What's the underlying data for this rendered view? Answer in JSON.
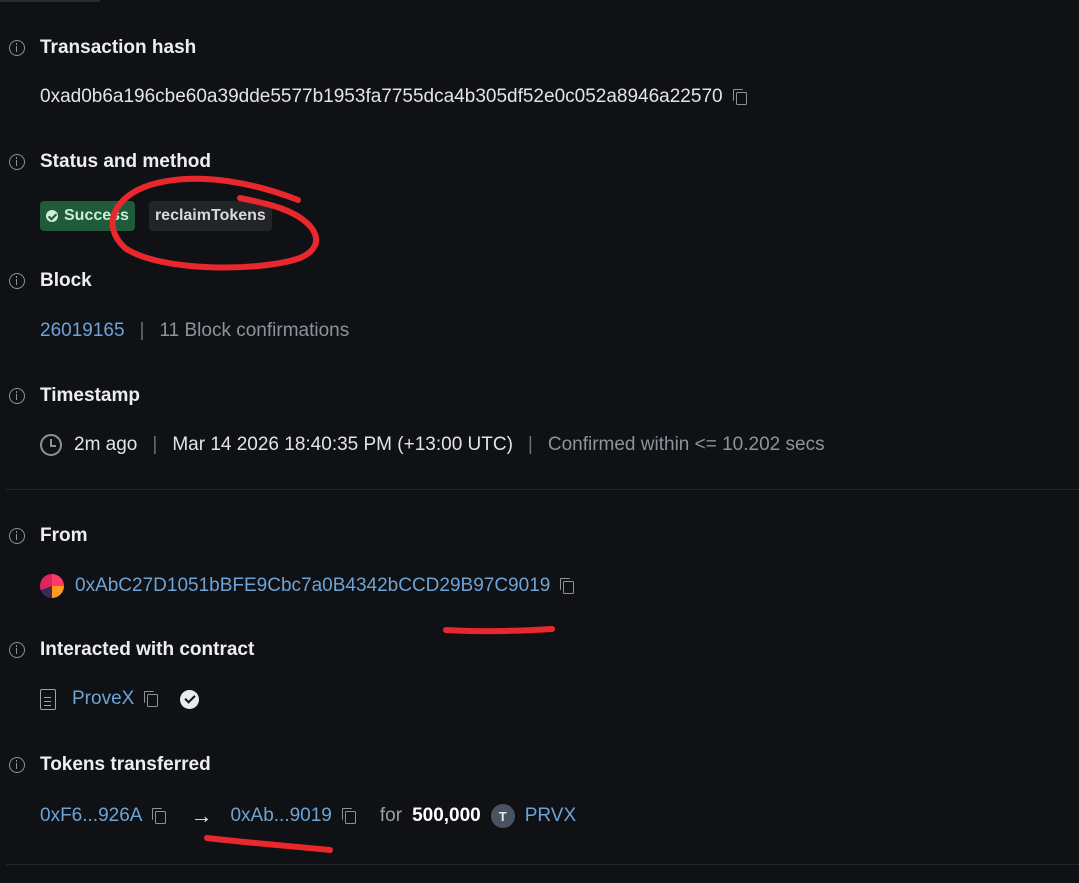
{
  "transaction_hash": {
    "label": "Transaction hash",
    "value": "0xad0b6a196cbe60a39dde5577b1953fa7755dca4b305df52e0c052a8946a22570"
  },
  "status_method": {
    "label": "Status and method",
    "status": "Success",
    "method": "reclaimTokens"
  },
  "block": {
    "label": "Block",
    "number": "26019165",
    "separator": "|",
    "confirmations": "11 Block confirmations"
  },
  "timestamp": {
    "label": "Timestamp",
    "relative": "2m ago",
    "separator": "|",
    "datetime": "Mar 14 2026 18:40:35 PM (+13:00 UTC)",
    "confirmed": "Confirmed within <= 10.202 secs"
  },
  "from": {
    "label": "From",
    "address": "0xAbC27D1051bBFE9Cbc7a0B4342bCCD29B97C9019"
  },
  "contract": {
    "label": "Interacted with contract",
    "name": "ProveX"
  },
  "tokens": {
    "label": "Tokens transferred",
    "from_short": "0xF6...926A",
    "arrow": "→",
    "to_short": "0xAb...9019",
    "for_word": "for",
    "amount": "500,000",
    "token_letter": "T",
    "token_symbol": "PRVX"
  },
  "colors": {
    "background": "#101114",
    "link": "#6ea3d6",
    "success_bg": "#1f5a3a",
    "annotation_red": "#e8282c"
  }
}
